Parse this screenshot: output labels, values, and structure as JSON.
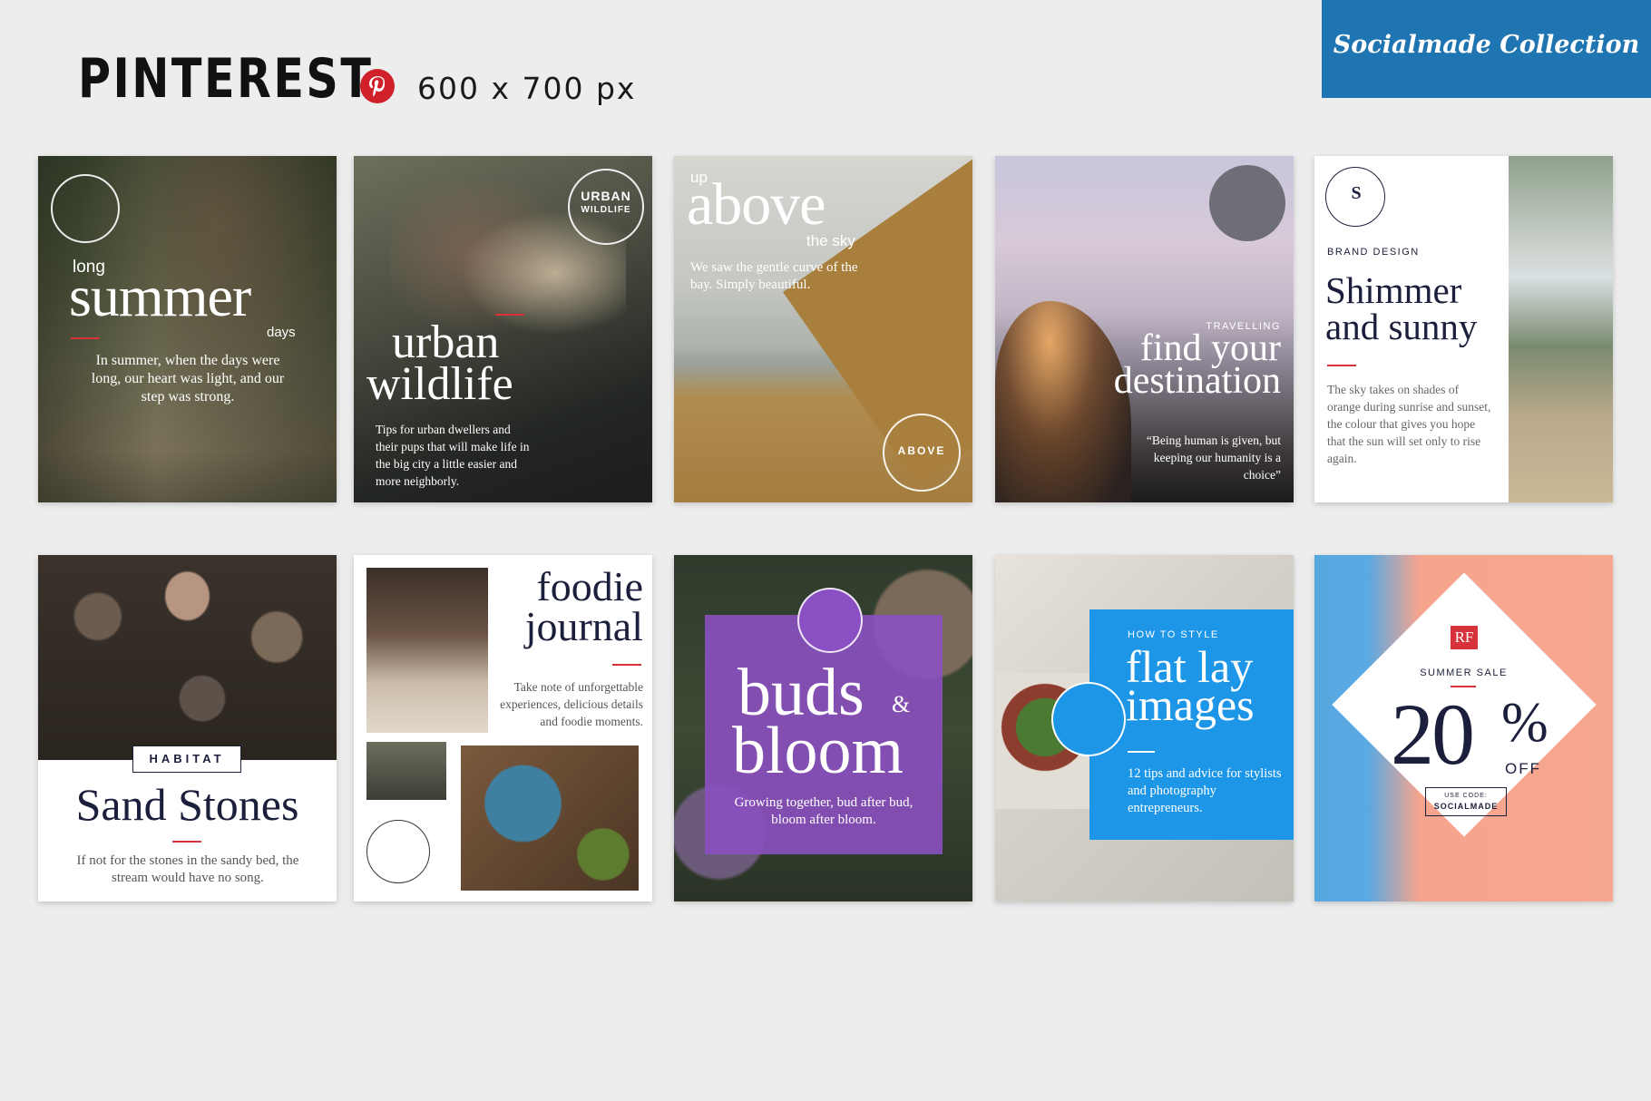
{
  "header": {
    "title": "PINTEREST",
    "size": "600 x 700 px",
    "brand": "Socialmade Collection",
    "icon": "pinterest-icon",
    "brand_color": "#1f74b2",
    "pin_color": "#d0202a"
  },
  "cards": {
    "c1": {
      "prefix": "long",
      "title": "summer",
      "suffix": "days",
      "body": "In summer, when the days were long, our heart was light, and our step was strong."
    },
    "c2": {
      "badge_top": "URBAN",
      "badge_bottom": "WILDLIFE",
      "title1": "urban",
      "title2": "wildlife",
      "body": "Tips for urban dwellers and their pups that will make life in the big city a little easier and more neighborly."
    },
    "c3": {
      "prefix": "up",
      "title": "above",
      "suffix": "the sky",
      "body": "We saw the gentle curve of the bay. Simply beautiful.",
      "seal": "ABOVE"
    },
    "c4": {
      "kicker": "TRAVELLING",
      "title1": "find your",
      "title2": "destination",
      "quote": "“Being human is given, but keeping our humanity is a choice”"
    },
    "c5": {
      "seal_letter": "S",
      "kicker": "BRAND DESIGN",
      "title1": "Shimmer",
      "title2": "and sunny",
      "body": "The sky takes on shades of orange during sunrise and sunset, the colour that gives you hope that the sun will set only to rise again."
    },
    "c6": {
      "label": "HABITAT",
      "title": "Sand Stones",
      "body": "If not for the stones in the sandy bed, the stream would have no song."
    },
    "c7": {
      "title1": "foodie",
      "title2": "journal",
      "body": "Take note of unforgettable experiences, delicious details and foodie moments."
    },
    "c8": {
      "title1": "buds",
      "amp": "&",
      "title2": "bloom",
      "body": "Growing together, bud after bud, bloom after bloom."
    },
    "c9": {
      "kicker": "HOW TO STYLE",
      "title1": "flat lay",
      "title2": "images",
      "body": "12 tips and advice for stylists and photography entrepreneurs."
    },
    "c10": {
      "logo": "RF",
      "kicker": "SUMMER SALE",
      "big": "20",
      "pct": "%",
      "off": "OFF",
      "code_label": "USE CODE:",
      "code": "SOCIALMADE"
    }
  }
}
